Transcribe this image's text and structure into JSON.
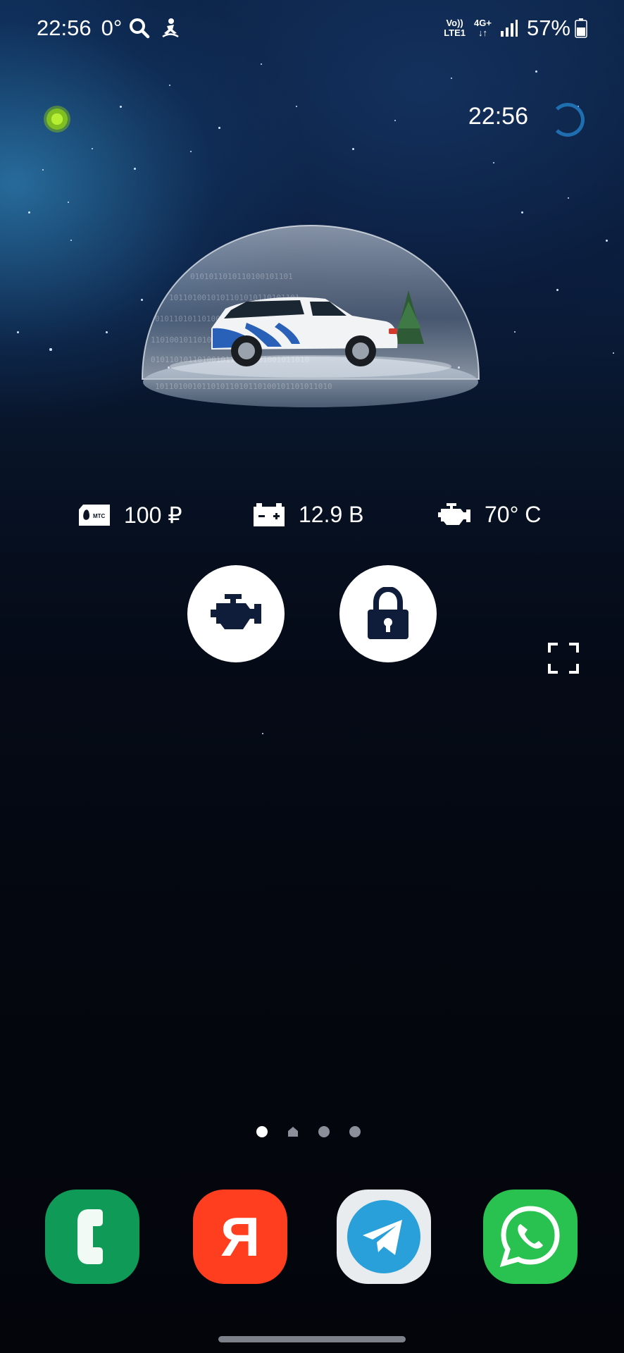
{
  "status_bar": {
    "time": "22:56",
    "temperature": "0°",
    "network_top": "Vo))",
    "network_bottom": "LTE1",
    "data_type": "4G+",
    "battery_percent": "57%",
    "icons": [
      "search-icon",
      "accessibility-icon",
      "signal-icon",
      "battery-icon"
    ]
  },
  "widget": {
    "clock": "22:56",
    "status_indicator_color": "#9fdc2a",
    "stats": [
      {
        "icon": "sim-card-icon",
        "label": "МТС",
        "value": "100 ₽"
      },
      {
        "icon": "battery-voltage-icon",
        "value": "12.9 В"
      },
      {
        "icon": "engine-temperature-icon",
        "value": "70° С"
      }
    ],
    "buttons": [
      {
        "icon": "engine-start-icon",
        "name": "engine-start"
      },
      {
        "icon": "lock-icon",
        "name": "lock"
      }
    ]
  },
  "pager": {
    "pages": 4,
    "active_index": 0,
    "home_index": 1
  },
  "dock": {
    "apps": [
      {
        "name": "phone",
        "icon": "phone-icon",
        "color": "#0f9b57"
      },
      {
        "name": "yandex",
        "icon": "yandex-icon",
        "letter": "Я",
        "color": "#ff3d1f"
      },
      {
        "name": "telegram",
        "icon": "telegram-icon",
        "color": "#2aa0da"
      },
      {
        "name": "whatsapp",
        "icon": "whatsapp-icon",
        "color": "#29c14f"
      }
    ]
  }
}
